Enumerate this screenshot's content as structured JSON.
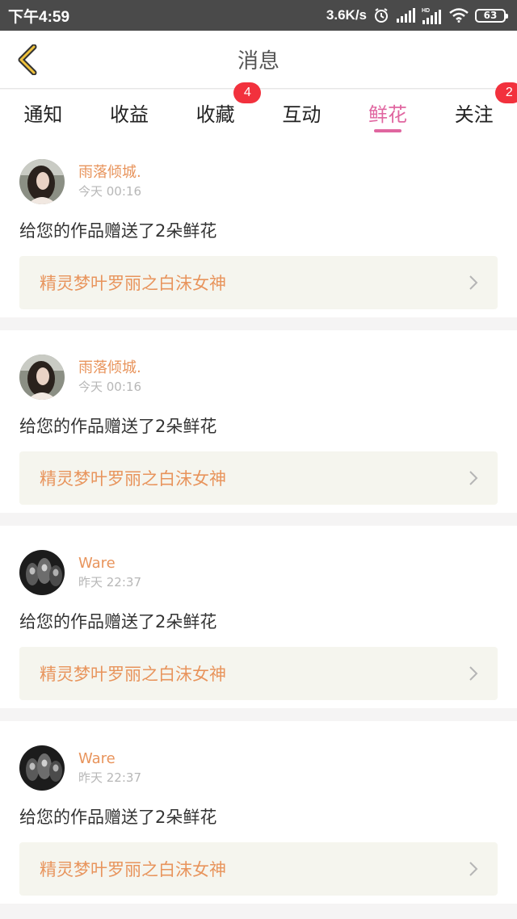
{
  "status_bar": {
    "time": "下午4:59",
    "speed": "3.6K/s",
    "battery": "63",
    "icons": [
      "alarm-icon",
      "signal-icon",
      "hd-signal-icon",
      "wifi-icon",
      "battery-icon"
    ]
  },
  "header": {
    "title": "消息",
    "back_icon": "chevron-left-icon",
    "accent_color": "#f0c23c"
  },
  "tabs": [
    {
      "label": "通知",
      "badge": ""
    },
    {
      "label": "收益",
      "badge": ""
    },
    {
      "label": "收藏",
      "badge": "4"
    },
    {
      "label": "互动",
      "badge": ""
    },
    {
      "label": "鲜花",
      "badge": "",
      "active": true
    },
    {
      "label": "关注",
      "badge": "2"
    }
  ],
  "colors": {
    "active_tab": "#e066a0",
    "badge": "#f2313d",
    "username": "#e8945c",
    "work_bg": "#f5f5ee"
  },
  "messages": [
    {
      "name": "雨落倾城.",
      "time": "今天 00:16",
      "text": "给您的作品赠送了2朵鲜花",
      "work": "精灵梦叶罗丽之白沫女神"
    },
    {
      "name": "雨落倾城.",
      "time": "今天 00:16",
      "text": "给您的作品赠送了2朵鲜花",
      "work": "精灵梦叶罗丽之白沫女神"
    },
    {
      "name": "Ware",
      "time": "昨天 22:37",
      "text": "给您的作品赠送了2朵鲜花",
      "work": "精灵梦叶罗丽之白沫女神"
    },
    {
      "name": "Ware",
      "time": "昨天 22:37",
      "text": "给您的作品赠送了2朵鲜花",
      "work": "精灵梦叶罗丽之白沫女神"
    }
  ]
}
